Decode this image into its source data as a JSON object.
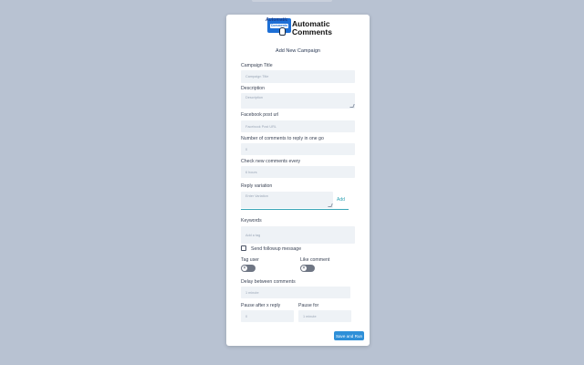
{
  "app": {
    "logo_line1": "Automatic",
    "logo_line2": "Comments",
    "title_line1": "Automatic",
    "title_line2": "Comments"
  },
  "form": {
    "subtitle": "Add New Campaign",
    "campaign_title": {
      "label": "Campaign Title",
      "placeholder": "Campaign Title"
    },
    "description": {
      "label": "Description",
      "placeholder": "Description"
    },
    "facebook_url": {
      "label": "Facebook post url",
      "placeholder": "Facebook Post URL"
    },
    "comments_per_go": {
      "label": "Number of comments to reply in one go",
      "value": "0"
    },
    "check_every": {
      "label": "Check new comments every",
      "value": "6 hours"
    },
    "reply_variation": {
      "label": "Reply variation",
      "placeholder": "Enter Variation",
      "add_label": "Add"
    },
    "keywords": {
      "label": "Keywords",
      "placeholder": "Add a tag"
    },
    "followup": {
      "label": "Send followup message",
      "checked": false
    },
    "tag_user": {
      "label": "Tag user",
      "on": false
    },
    "like_comment": {
      "label": "Like comment",
      "on": false
    },
    "delay": {
      "label": "Delay between comments",
      "value": "1 minute"
    },
    "pause_after": {
      "label": "Pause after x reply",
      "value": "0"
    },
    "pause_for": {
      "label": "Pause for",
      "value": "1 minute"
    },
    "submit_label": "Save and Run"
  },
  "colors": {
    "background": "#b8c2d2",
    "accent": "#2e8fd8",
    "field_bg": "#eef2f6",
    "link": "#2aa0b2"
  }
}
